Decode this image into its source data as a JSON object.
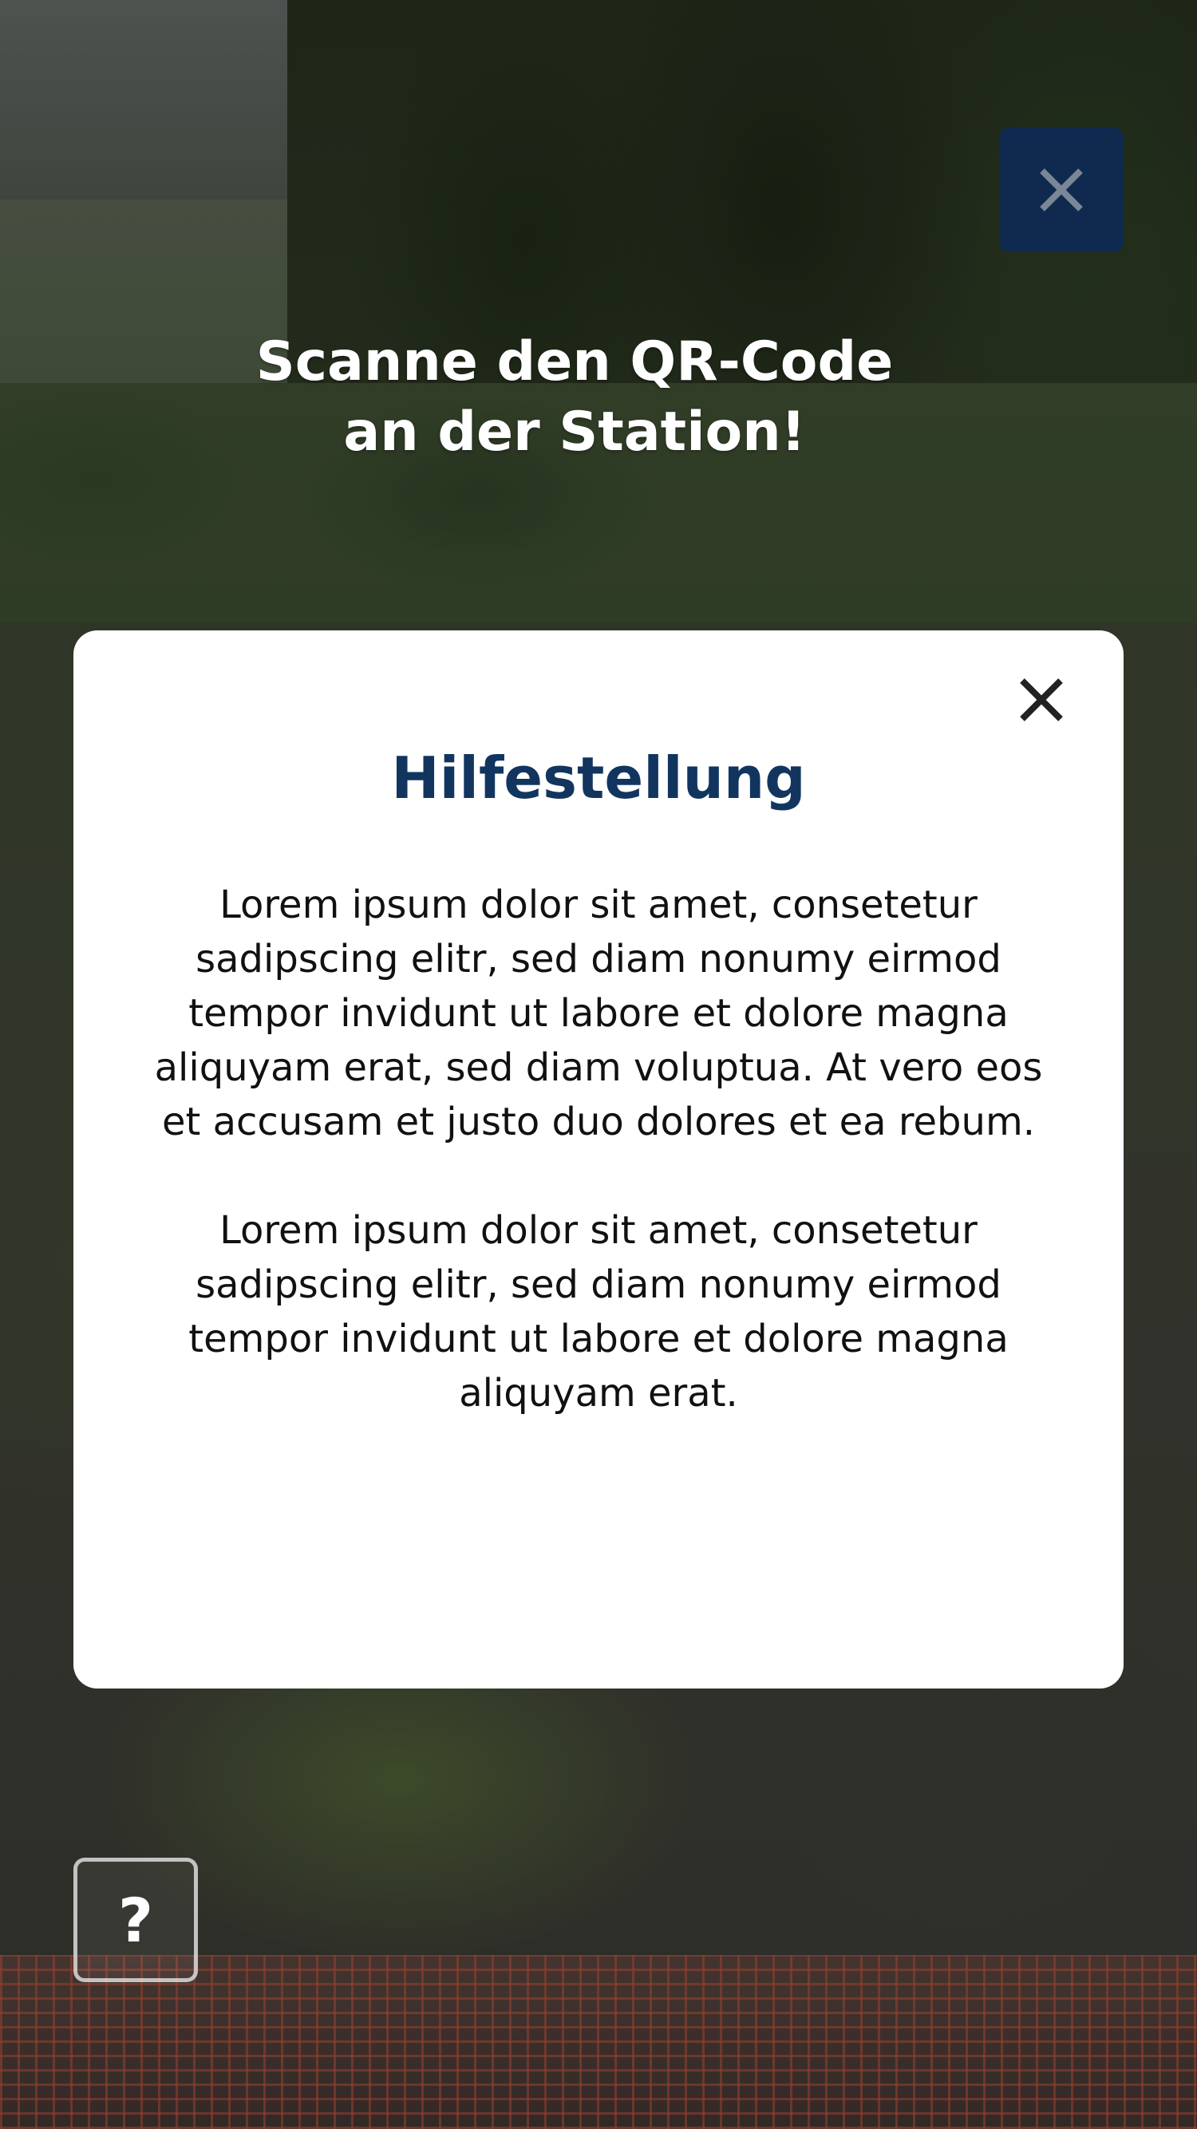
{
  "header": {
    "close_icon": "close-icon",
    "close_button_color": "#0f2a4e",
    "headline_line1": "Scanne den QR-Code",
    "headline_line2": "an der Station!"
  },
  "help_modal": {
    "title": "Hilfestellung",
    "title_color": "#12355f",
    "close_icon": "close-icon",
    "paragraph1": "Lorem ipsum dolor sit amet, consetetur sadipscing elitr, sed diam nonumy eirmod tempor invidunt ut labore et dolore magna aliquyam erat, sed diam voluptua. At vero eos et accusam et justo duo dolores et ea rebum.",
    "paragraph2": "Lorem ipsum dolor sit amet, consetetur sadipscing elitr, sed diam nonumy eirmod tempor invidunt ut labore et dolore magna aliquyam erat."
  },
  "help_button": {
    "label": "?"
  }
}
